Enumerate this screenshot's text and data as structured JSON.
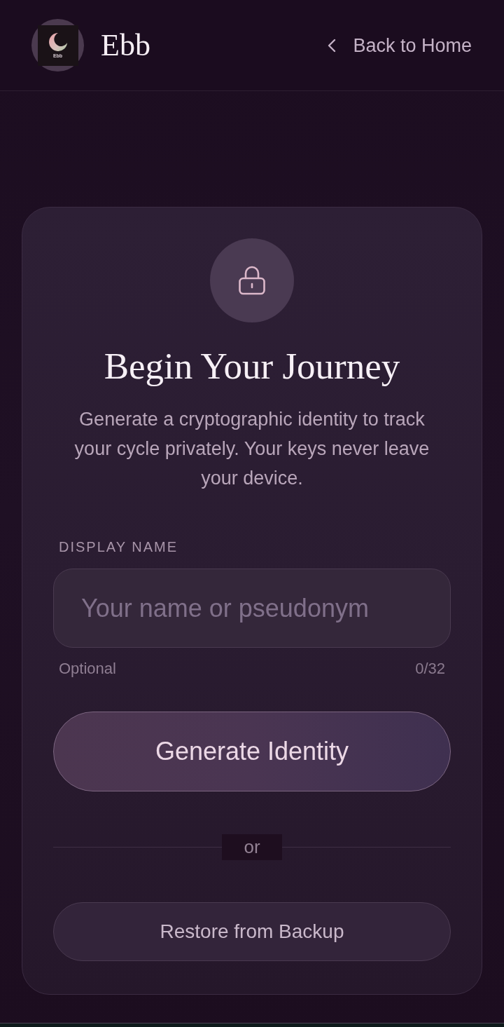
{
  "header": {
    "logo_caption": "Ebb",
    "app_name": "Ebb",
    "back_link": "Back to Home"
  },
  "card": {
    "title": "Begin Your Journey",
    "description": "Generate a cryptographic identity to track your cycle privately. Your keys never leave your device.",
    "field": {
      "label": "DISPLAY NAME",
      "placeholder": "Your name or pseudonym",
      "hint": "Optional",
      "counter": "0/32"
    },
    "primary_button": "Generate Identity",
    "divider_label": "or",
    "secondary_button": "Restore from Backup"
  }
}
